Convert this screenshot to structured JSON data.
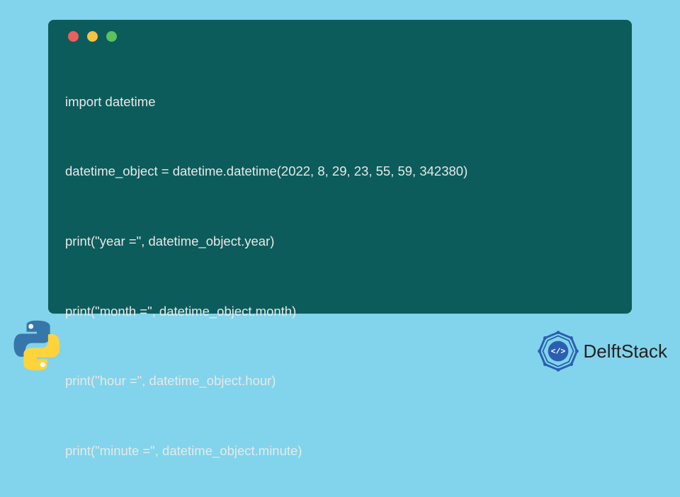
{
  "code": {
    "lines": [
      "import datetime",
      "datetime_object = datetime.datetime(2022, 8, 29, 23, 55, 59, 342380)",
      "print(\"year =\", datetime_object.year)",
      "print(\"month =\", datetime_object.month)",
      "print(\"hour =\", datetime_object.hour)",
      "print(\"minute =\", datetime_object.minute)"
    ]
  },
  "brand": {
    "delftstack_label": "DelftStack"
  },
  "colors": {
    "page_bg": "#81d4eb",
    "window_bg": "#0d5c5c",
    "code_fg": "#e8e8e8",
    "delft_primary": "#2a5fb0"
  }
}
